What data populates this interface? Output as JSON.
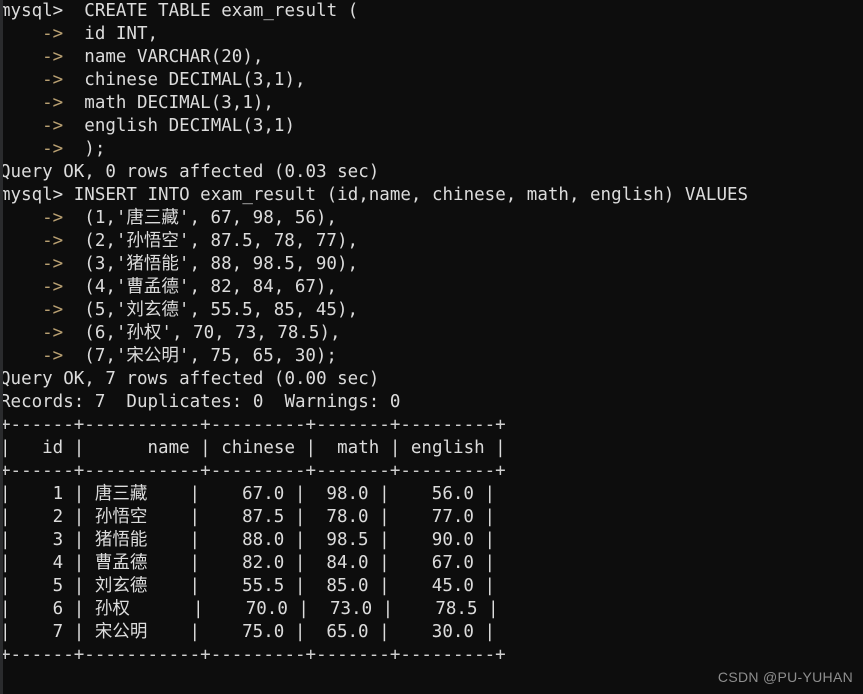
{
  "terminal": {
    "prompt": "mysql>",
    "continuation": "    ->",
    "background_color": "#0d0d0d",
    "text_color": "#d8d8d8",
    "arrow_color": "#b9a072",
    "lines": [
      {
        "type": "prompt",
        "prefix": "mysql>",
        "text": "  CREATE TABLE exam_result ("
      },
      {
        "type": "cont",
        "prefix": "    ->",
        "text": "  id INT,"
      },
      {
        "type": "cont",
        "prefix": "    ->",
        "text": "  name VARCHAR(20),"
      },
      {
        "type": "cont",
        "prefix": "    ->",
        "text": "  chinese DECIMAL(3,1),"
      },
      {
        "type": "cont",
        "prefix": "    ->",
        "text": "  math DECIMAL(3,1),"
      },
      {
        "type": "cont",
        "prefix": "    ->",
        "text": "  english DECIMAL(3,1)"
      },
      {
        "type": "cont",
        "prefix": "    ->",
        "text": "  );"
      },
      {
        "type": "output",
        "prefix": "",
        "text": "Query OK, 0 rows affected (0.03 sec)"
      },
      {
        "type": "prompt",
        "prefix": "mysql>",
        "text": " INSERT INTO exam_result (id,name, chinese, math, english) VALUES"
      },
      {
        "type": "cont",
        "prefix": "    ->",
        "text": "  (1,'唐三藏', 67, 98, 56),"
      },
      {
        "type": "cont",
        "prefix": "    ->",
        "text": "  (2,'孙悟空', 87.5, 78, 77),"
      },
      {
        "type": "cont",
        "prefix": "    ->",
        "text": "  (3,'猪悟能', 88, 98.5, 90),"
      },
      {
        "type": "cont",
        "prefix": "    ->",
        "text": "  (4,'曹孟德', 82, 84, 67),"
      },
      {
        "type": "cont",
        "prefix": "    ->",
        "text": "  (5,'刘玄德', 55.5, 85, 45),"
      },
      {
        "type": "cont",
        "prefix": "    ->",
        "text": "  (6,'孙权', 70, 73, 78.5),"
      },
      {
        "type": "cont",
        "prefix": "    ->",
        "text": "  (7,'宋公明', 75, 65, 30);"
      },
      {
        "type": "output",
        "prefix": "",
        "text": "Query OK, 7 rows affected (0.00 sec)"
      },
      {
        "type": "output",
        "prefix": "",
        "text": "Records: 7  Duplicates: 0  Warnings: 0"
      }
    ]
  },
  "result_table": {
    "rule": "+------+-----------+---------+-------+---------+",
    "header_row": "|  id  | name      | chinese | math  | english |",
    "columns": [
      "id",
      "name",
      "chinese",
      "math",
      "english"
    ],
    "rows": [
      {
        "id": "1",
        "name": "唐三藏",
        "chinese": "67.0",
        "math": "98.0",
        "english": "56.0"
      },
      {
        "id": "2",
        "name": "孙悟空",
        "chinese": "87.5",
        "math": "78.0",
        "english": "77.0"
      },
      {
        "id": "3",
        "name": "猪悟能",
        "chinese": "88.0",
        "math": "98.5",
        "english": "90.0"
      },
      {
        "id": "4",
        "name": "曹孟德",
        "chinese": "82.0",
        "math": "84.0",
        "english": "67.0"
      },
      {
        "id": "5",
        "name": "刘玄德",
        "chinese": "55.5",
        "math": "85.0",
        "english": "45.0"
      },
      {
        "id": "6",
        "name": "孙权",
        "chinese": "70.0",
        "math": "73.0",
        "english": "78.5"
      },
      {
        "id": "7",
        "name": "宋公明",
        "chinese": "75.0",
        "math": "65.0",
        "english": "30.0"
      }
    ]
  },
  "watermark": {
    "text": "CSDN @PU-YUHAN"
  }
}
